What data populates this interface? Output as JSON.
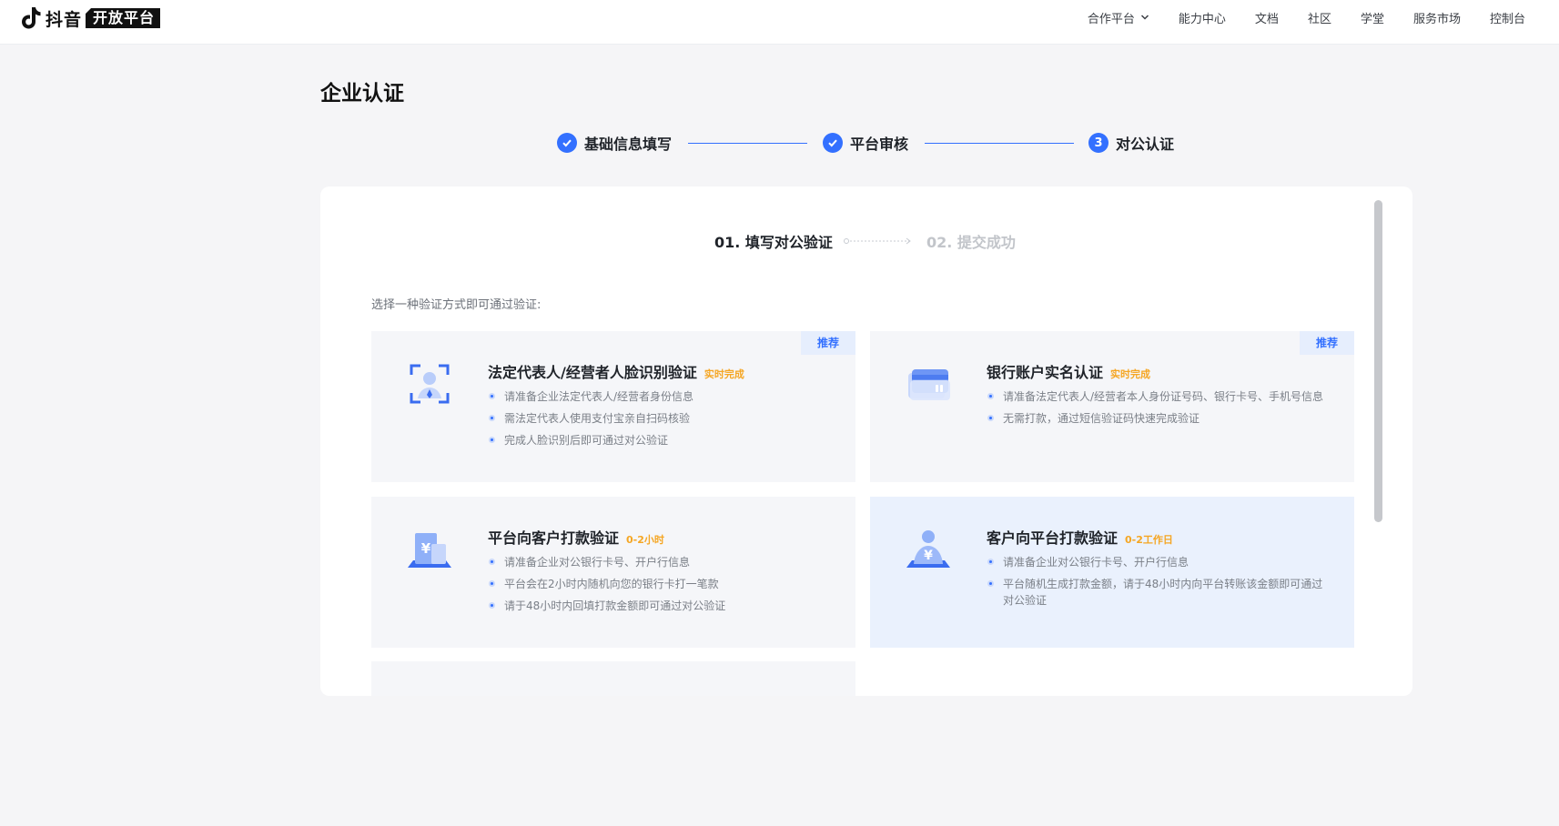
{
  "brand": {
    "name": "抖音",
    "badge": "开放平台"
  },
  "nav": {
    "items": [
      {
        "label": "合作平台",
        "has_dropdown": true
      },
      {
        "label": "能力中心"
      },
      {
        "label": "文档"
      },
      {
        "label": "社区"
      },
      {
        "label": "学堂"
      },
      {
        "label": "服务市场"
      },
      {
        "label": "控制台"
      }
    ]
  },
  "page": {
    "title": "企业认证"
  },
  "steps": [
    {
      "label": "基础信息填写",
      "status": "done"
    },
    {
      "label": "平台审核",
      "status": "done"
    },
    {
      "label": "对公认证",
      "status": "current",
      "number": "3"
    }
  ],
  "substeps": {
    "current": "01. 填写对公验证",
    "next": "02. 提交成功"
  },
  "hint": "选择一种验证方式即可通过验证:",
  "options": [
    {
      "title": "法定代表人/经营者人脸识别验证",
      "badge": "实时完成",
      "tag": "推荐",
      "icon": "face-scan-icon",
      "items": [
        "请准备企业法定代表人/经营者身份信息",
        "需法定代表人使用支付宝亲自扫码核验",
        "完成人脸识别后即可通过对公验证"
      ]
    },
    {
      "title": "银行账户实名认证",
      "badge": "实时完成",
      "tag": "推荐",
      "icon": "bank-card-icon",
      "items": [
        "请准备法定代表人/经营者本人身份证号码、银行卡号、手机号信息",
        "无需打款，通过短信验证码快速完成验证"
      ]
    },
    {
      "title": "平台向客户打款验证",
      "badge": "0-2小时",
      "icon": "building-yuan-icon",
      "items": [
        "请准备企业对公银行卡号、开户行信息",
        "平台会在2小时内随机向您的银行卡打一笔款",
        "请于48小时内回填打款金额即可通过对公验证"
      ]
    },
    {
      "title": "客户向平台打款验证",
      "badge": "0-2工作日",
      "icon": "person-yuan-icon",
      "selected": true,
      "items": [
        "请准备企业对公银行卡号、开户行信息",
        "平台随机生成打款金额，请于48小时内向平台转账该金额即可通过对公验证"
      ]
    }
  ],
  "colors": {
    "primary": "#3370ff",
    "badge": "#f5a623",
    "selected_bg": "#eaf1fd",
    "card_bg": "#f5f6f9"
  }
}
